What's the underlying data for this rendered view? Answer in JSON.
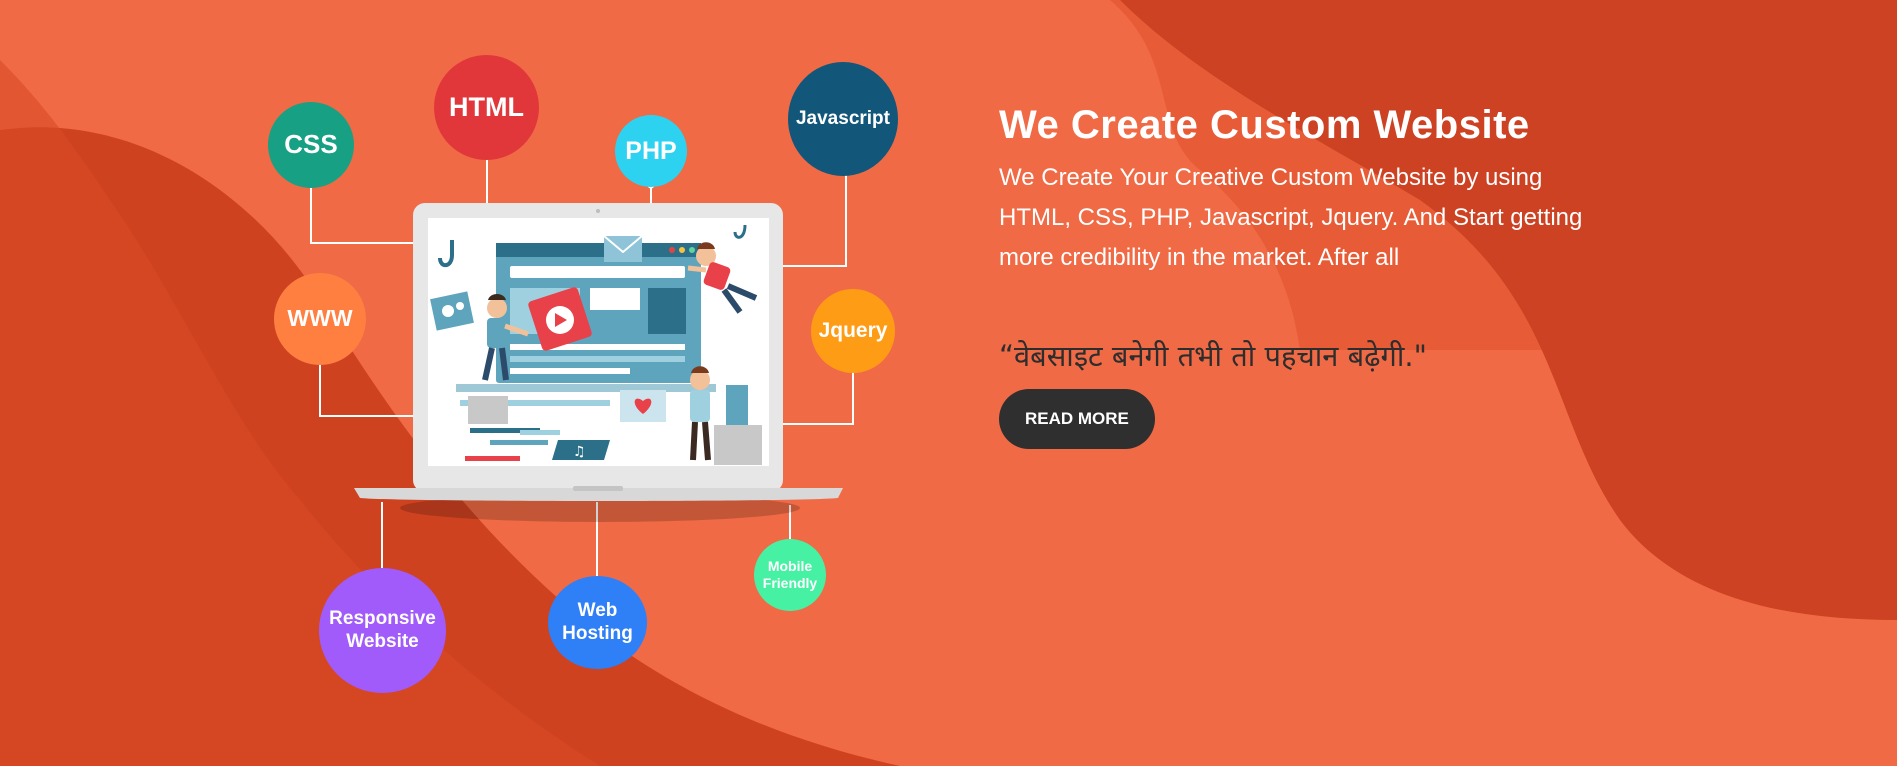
{
  "colors": {
    "background": "#f06a45",
    "background_dark": "#cf4220",
    "button": "#2f2f2f",
    "tagline": "#2d2d2d"
  },
  "bubbles": {
    "css": {
      "label": "CSS",
      "color": "#17a084"
    },
    "html": {
      "label": "HTML",
      "color": "#e2373a"
    },
    "php": {
      "label": "PHP",
      "color": "#2dd2f0"
    },
    "javascript": {
      "label": "Javascript",
      "color": "#12577a"
    },
    "www": {
      "label": "WWW",
      "color": "#ff7f41"
    },
    "jquery": {
      "label": "Jquery",
      "color": "#ff9c16"
    },
    "responsive": {
      "line1": "Responsive",
      "line2": "Website",
      "color": "#a05bfa"
    },
    "hosting": {
      "line1": "Web",
      "line2": "Hosting",
      "color": "#2f7ff7"
    },
    "mobile": {
      "line1": "Mobile",
      "line2": "Friendly",
      "color": "#46f1a3"
    }
  },
  "hero": {
    "title": "We Create Custom Website",
    "description": "We Create Your Creative Custom Website by using HTML, CSS, PHP, Javascript, Jquery. And Start getting more credibility in the market. After all",
    "tagline": "“वेबसाइट बनेगी तभी तो पहचान बढ़ेगी.\"",
    "button_label": "READ MORE"
  }
}
